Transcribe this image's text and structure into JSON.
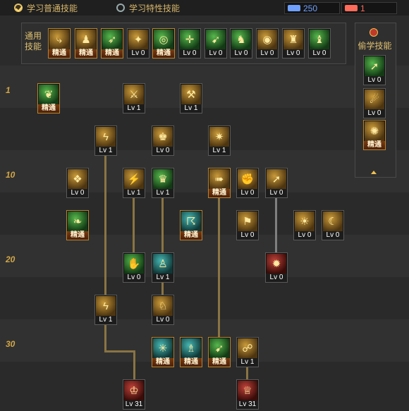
{
  "tabs": {
    "normal": "学习普通技能",
    "special": "学习特性技能"
  },
  "counters": {
    "sp": "250",
    "tp": "1",
    "sp_color": "#6fa0ff",
    "tp_color": "#ff6b5a"
  },
  "common": {
    "title": "通用技能",
    "skills": [
      {
        "icon": "kneel-icon",
        "glyph": "⤷",
        "tone": "gold",
        "caption": "精通",
        "master": true
      },
      {
        "icon": "crouch-icon",
        "glyph": "♟",
        "tone": "gold",
        "caption": "精通",
        "master": true
      },
      {
        "icon": "dash-icon",
        "glyph": "➶",
        "tone": "green",
        "caption": "精通",
        "master": true
      },
      {
        "icon": "wings-icon",
        "glyph": "✦",
        "tone": "gold",
        "caption": "Lv 0",
        "master": false
      },
      {
        "icon": "target-icon",
        "glyph": "◎",
        "tone": "green",
        "caption": "精通",
        "master": true
      },
      {
        "icon": "crosshair-icon",
        "glyph": "✛",
        "tone": "green",
        "caption": "Lv 0",
        "master": false
      },
      {
        "icon": "runner-icon",
        "glyph": "➹",
        "tone": "green",
        "caption": "Lv 0",
        "master": false
      },
      {
        "icon": "fighter-icon",
        "glyph": "♞",
        "tone": "green",
        "caption": "Lv 0",
        "master": false
      },
      {
        "icon": "shield-icon",
        "glyph": "◉",
        "tone": "gold",
        "caption": "Lv 0",
        "master": false
      },
      {
        "icon": "strongman-icon",
        "glyph": "♜",
        "tone": "gold",
        "caption": "Lv 0",
        "master": false
      },
      {
        "icon": "figure-icon",
        "glyph": "♝",
        "tone": "green",
        "caption": "Lv 0",
        "master": false
      }
    ]
  },
  "steal": {
    "title": "偷学技能",
    "skills": [
      {
        "icon": "jump-icon",
        "glyph": "➚",
        "tone": "green",
        "caption": "Lv 0",
        "master": false
      },
      {
        "icon": "bow-icon",
        "glyph": "☄",
        "tone": "gold",
        "caption": "Lv 0",
        "master": false
      },
      {
        "icon": "flame-icon",
        "glyph": "✺",
        "tone": "gold",
        "caption": "精通",
        "master": true
      }
    ]
  },
  "levels": [
    "1",
    "10",
    "20",
    "30"
  ],
  "tree": [
    {
      "icon": "leaf-icon",
      "glyph": "❦",
      "tone": "green",
      "caption": "精通",
      "master": true
    },
    {
      "icon": "claw-icon",
      "glyph": "⚔",
      "tone": "gold",
      "caption": "Lv 1",
      "master": false
    },
    {
      "icon": "slash-icon",
      "glyph": "⚒",
      "tone": "gold",
      "caption": "Lv 1",
      "master": false
    },
    {
      "icon": "spiral-kick-icon",
      "glyph": "ϟ",
      "tone": "gold",
      "caption": "Lv 1",
      "master": false
    },
    {
      "icon": "boxer-icon",
      "glyph": "♚",
      "tone": "gold",
      "caption": "Lv 0",
      "master": false
    },
    {
      "icon": "burst-icon",
      "glyph": "✷",
      "tone": "gold",
      "caption": "Lv 1",
      "master": false
    },
    {
      "icon": "dust-icon",
      "glyph": "❖",
      "tone": "gold",
      "caption": "Lv 0",
      "master": false
    },
    {
      "icon": "lightning-icon",
      "glyph": "⚡",
      "tone": "gold",
      "caption": "Lv 1",
      "master": false
    },
    {
      "icon": "muscle-icon",
      "glyph": "♛",
      "tone": "green",
      "caption": "Lv 1",
      "master": false
    },
    {
      "icon": "sprint-icon",
      "glyph": "➠",
      "tone": "gold",
      "caption": "精通",
      "master": true
    },
    {
      "icon": "punch-icon",
      "glyph": "✊",
      "tone": "gold",
      "caption": "Lv 0",
      "master": false
    },
    {
      "icon": "leap-icon",
      "glyph": "➚",
      "tone": "gold",
      "caption": "Lv 0",
      "master": false
    },
    {
      "icon": "wind-icon",
      "glyph": "❧",
      "tone": "green",
      "caption": "精通",
      "master": true
    },
    {
      "icon": "storm-icon",
      "glyph": "☈",
      "tone": "teal",
      "caption": "精通",
      "master": true
    },
    {
      "icon": "strike-icon",
      "glyph": "⚑",
      "tone": "gold",
      "caption": "Lv 0",
      "master": false
    },
    {
      "icon": "fireball-icon",
      "glyph": "☀",
      "tone": "gold",
      "caption": "Lv 0",
      "master": false
    },
    {
      "icon": "whirl-icon",
      "glyph": "☾",
      "tone": "gold",
      "caption": "Lv 0",
      "master": false
    },
    {
      "icon": "energy-hand-icon",
      "glyph": "✋",
      "tone": "green",
      "caption": "Lv 0",
      "master": false
    },
    {
      "icon": "aura-body-icon",
      "glyph": "♙",
      "tone": "teal",
      "caption": "Lv 1",
      "master": false
    },
    {
      "icon": "cannon-icon",
      "glyph": "✹",
      "tone": "red",
      "caption": "Lv 0",
      "master": false
    },
    {
      "icon": "kick-icon",
      "glyph": "ϟ",
      "tone": "gold",
      "caption": "Lv 1",
      "master": false
    },
    {
      "icon": "grab-icon",
      "glyph": "♘",
      "tone": "gold",
      "caption": "Lv 0",
      "master": false
    },
    {
      "icon": "shatter-icon",
      "glyph": "✳",
      "tone": "teal",
      "caption": "精通",
      "master": true
    },
    {
      "icon": "spirit-icon",
      "glyph": "♗",
      "tone": "teal",
      "caption": "精通",
      "master": true
    },
    {
      "icon": "rush-icon",
      "glyph": "➹",
      "tone": "green",
      "caption": "精通",
      "master": true
    },
    {
      "icon": "ground-slam-icon",
      "glyph": "☍",
      "tone": "gold",
      "caption": "Lv 1",
      "master": false
    },
    {
      "icon": "awakening-icon",
      "glyph": "♔",
      "tone": "red",
      "caption": "Lv 31",
      "master": false
    },
    {
      "icon": "awakening-2-icon",
      "glyph": "♕",
      "tone": "red",
      "caption": "Lv 31",
      "master": false
    }
  ]
}
